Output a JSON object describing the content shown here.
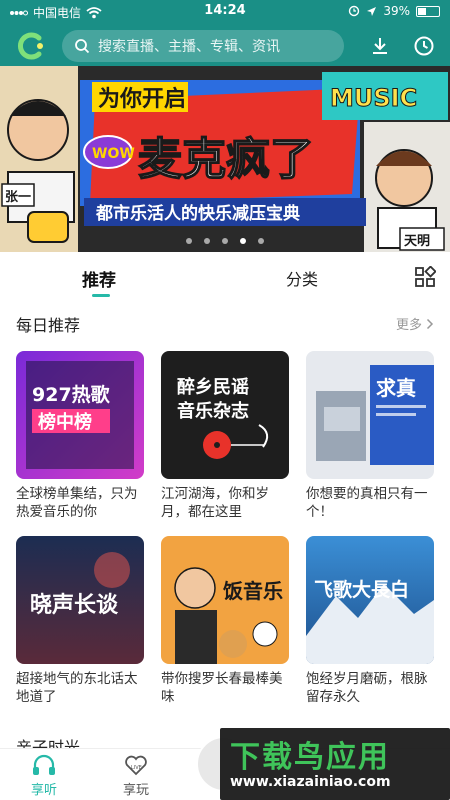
{
  "status_bar": {
    "carrier": "中国电信",
    "time": "14:24",
    "battery_text": "39%",
    "battery_level": 0.39
  },
  "header": {
    "search_placeholder": "搜索直播、主播、专辑、资讯",
    "icons": [
      "logo-icon",
      "search-icon",
      "download-icon",
      "history-icon"
    ]
  },
  "banner": {
    "top_label": "为你开启",
    "wow": "WOW",
    "title": "麦克疯了",
    "subtitle": "都市乐活人的快乐减压宝典",
    "music_logo": "MUSIC",
    "left_name": "张一",
    "right_name": "天明",
    "dot_count": 5,
    "active_dot": 3
  },
  "tabs": {
    "recommend": "推荐",
    "category": "分类"
  },
  "daily": {
    "title": "每日推荐",
    "more": "更多",
    "cards": [
      {
        "cover_line1": "927热歌",
        "cover_line2": "榜中榜",
        "caption": "全球榜单集结，只为热爱音乐的你"
      },
      {
        "cover_line1": "醉乡民谣",
        "cover_line2": "音乐杂志",
        "caption": "江河湖海，你和岁月，都在这里"
      },
      {
        "cover_line1": "求真",
        "cover_line2": "",
        "caption": "你想要的真相只有一个！"
      },
      {
        "cover_line1": "晓声长谈",
        "cover_line2": "",
        "caption": "超接地气的东北话太地道了"
      },
      {
        "cover_line1": "饭音乐",
        "cover_line2": "",
        "caption": "带你搜罗长春最棒美味"
      },
      {
        "cover_line1": "飞歌大長白",
        "cover_line2": "",
        "caption": "饱经岁月磨砺，根脉留存永久"
      }
    ]
  },
  "next_section_partial": "亲子时光",
  "bottom_nav": {
    "listen": "享听",
    "play": "享玩"
  },
  "watermark": {
    "title": "下载鸟应用",
    "url": "www.xiazainiao.com"
  },
  "colors": {
    "accent": "#26b9a8",
    "header_bg": "#1a8f86"
  }
}
